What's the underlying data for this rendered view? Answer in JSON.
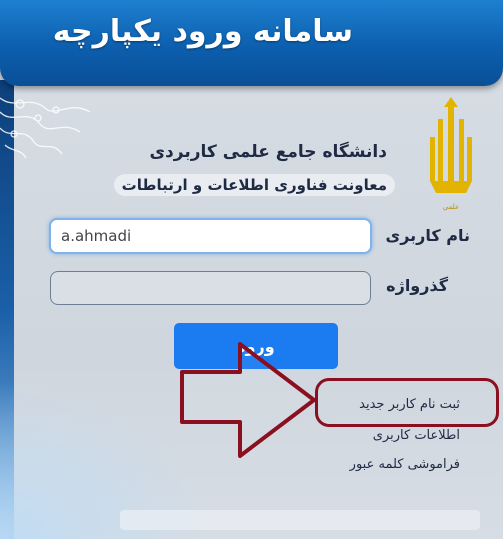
{
  "header": {
    "title": "سامانه ورود یکپارچه"
  },
  "org": {
    "university": "دانشگاه جامع علمی کاربردی",
    "department": "معاونت فناوری اطلاعات و ارتباطات",
    "logo_icon": "university-emblem-icon"
  },
  "form": {
    "username_label": "نام کاربری",
    "username_value": "a.ahmadi",
    "password_label": "گذرواژه",
    "password_value": "",
    "login_button": "ورود"
  },
  "links": {
    "register": "ثبت نام کاربر جدید",
    "user_info": "اطلاعات کاربری",
    "forgot_password": "فراموشی کلمه عبور"
  },
  "annotation": {
    "arrow_icon": "pointer-arrow-icon",
    "color": "#8a1020"
  },
  "colors": {
    "header": "#0c5fae",
    "button": "#1b7cf2",
    "panel": "#d3dae2"
  }
}
